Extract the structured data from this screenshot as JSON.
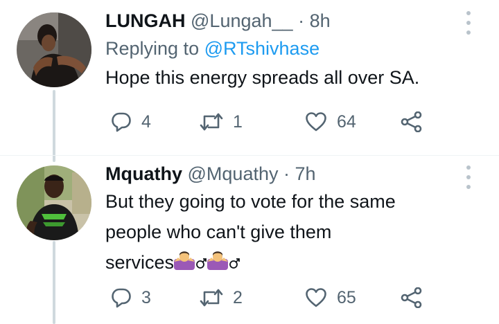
{
  "tweets": [
    {
      "display_name": "LUNGAH",
      "handle": "@Lungah__",
      "separator": "·",
      "time": "8h",
      "replying_prefix": "Replying to",
      "replying_to": "@RTshivhase",
      "text_lines": [
        "Hope this energy spreads all over SA."
      ],
      "emoji_suffix": "",
      "replies": "4",
      "retweets": "1",
      "likes": "64"
    },
    {
      "display_name": "Mquathy",
      "handle": "@Mquathy",
      "separator": "·",
      "time": "7h",
      "text_lines": [
        "But they going to vote for the same",
        "people who can't give them",
        "services"
      ],
      "emoji_suffix": "🤷‍♂️🤷‍♂️",
      "emoji_names": [
        "person-shrugging-male-emoji",
        "person-shrugging-male-emoji"
      ],
      "replies": "3",
      "retweets": "2",
      "likes": "65"
    }
  ],
  "icons": {
    "reply": "reply-bubble-icon",
    "retweet": "retweet-icon",
    "like": "heart-icon",
    "share": "share-icon",
    "more": "more-options-icon"
  },
  "colors": {
    "link": "#1d9bf0",
    "secondary_text": "#536471",
    "primary_text": "#0f1419",
    "thread_line": "#cfd9de"
  }
}
